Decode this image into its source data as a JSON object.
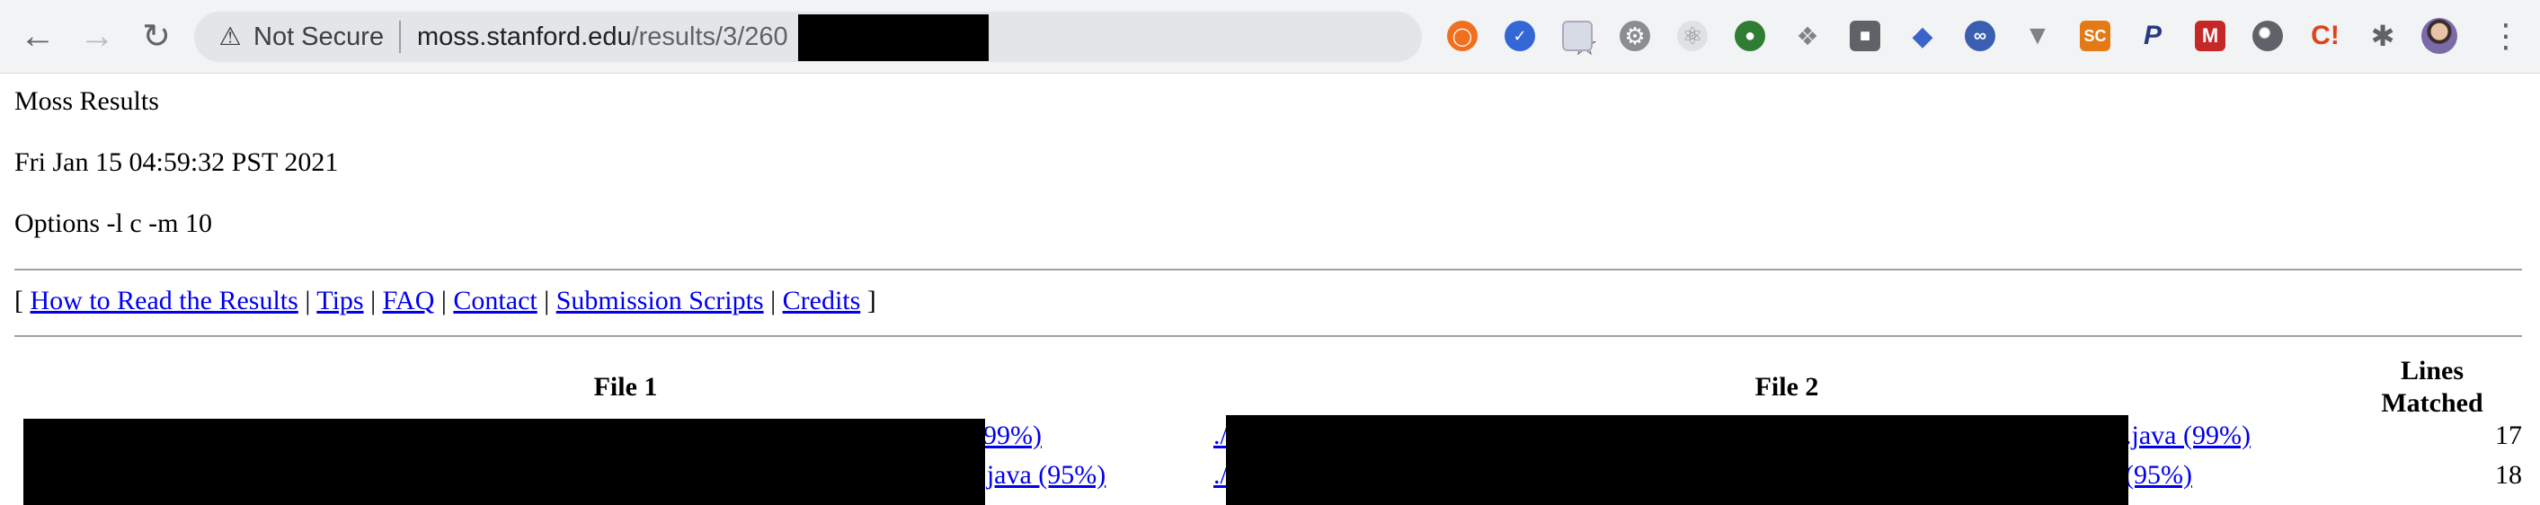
{
  "browser": {
    "security_label": "Not Secure",
    "url_host": "moss.stanford.edu",
    "url_path": "/results/3/260"
  },
  "extensions": [
    "ext-orange-circle",
    "ext-blue-check",
    "ext-calendar",
    "ext-gear",
    "ext-react-atom",
    "ext-green-q",
    "ext-dropbox",
    "ext-dark-square",
    "ext-blue-cap",
    "ext-blue-swirl",
    "ext-v-logo",
    "ext-sc",
    "ext-p",
    "ext-red-m",
    "ext-grey-orb",
    "ext-red-c",
    "puzzle-icon"
  ],
  "ext_labels": {
    "sc": "SC",
    "p": "P",
    "m": "M",
    "c": "C!"
  },
  "page": {
    "title": "Moss Results",
    "date": "Fri Jan 15 04:59:32 PST 2021",
    "options": "Options -l c -m 10",
    "nav": {
      "open": "[",
      "close": "]",
      "separator": "|",
      "links": [
        "How to Read the Results",
        "Tips",
        "FAQ",
        "Contact",
        "Submission Scripts",
        "Credits"
      ]
    },
    "table": {
      "headers": {
        "file1": "File 1",
        "file2": "File 2",
        "lines_line1": "Lines",
        "lines_line2": "Matched"
      },
      "rows": [
        {
          "file1_tail": " (99%)",
          "file2_head": "./",
          "file2_tail": ".java (99%)",
          "lines": "17"
        },
        {
          "file1_tail": "r.java (95%)",
          "file2_head": "./",
          "file2_tail": " (95%)",
          "lines": "18"
        }
      ]
    }
  }
}
